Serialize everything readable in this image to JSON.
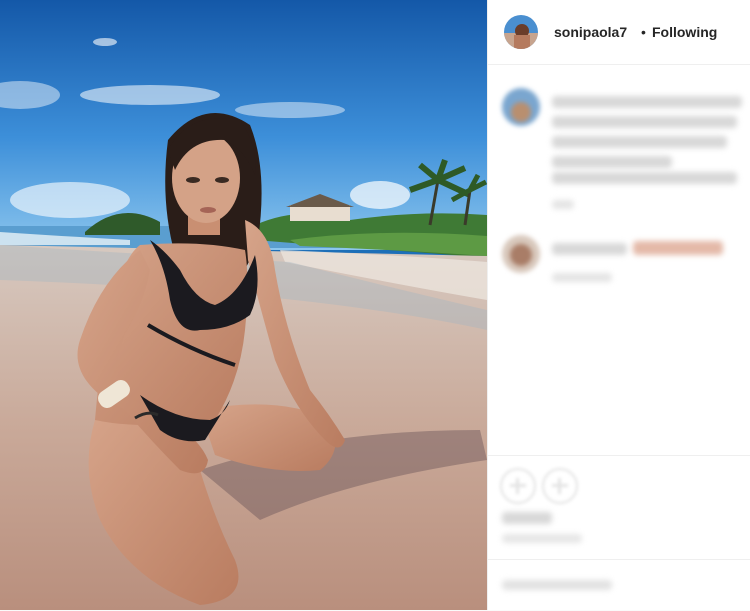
{
  "post": {
    "author": {
      "username": "sonipaola7",
      "separator": "•",
      "follow_status": "Following"
    },
    "photo": {
      "alt": ""
    },
    "comments_blurred": true
  },
  "colors": {
    "text_primary": "#262626",
    "text_secondary": "#8e8e8e",
    "border": "#efefef",
    "background": "#ffffff"
  }
}
